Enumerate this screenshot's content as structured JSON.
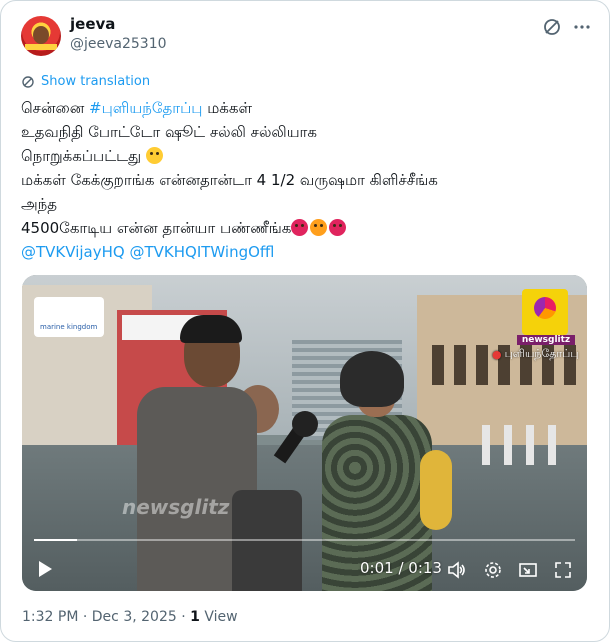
{
  "author": {
    "name": "jeeva",
    "handle": "@jeeva25310"
  },
  "translate_label": "Show translation",
  "tweet": {
    "line1_prefix": "சென்னை ",
    "line1_hashtag": "#புளியந்தோப்பு",
    "line1_suffix": " மக்கள்",
    "line2": " உதவநிதி போட்டோ ஷூட் சல்லி சல்லியாக",
    "line3": "நொறுக்கப்பட்டது",
    "line4": "மக்கள் கேக்குறாங்க என்னதான்டா 4 1/2 வருஷமா கிளிச்சீங்க",
    "line5": "அந்த",
    "line6": "4500கோடிய என்ன தான்யா பண்ணீங்க",
    "mention1": "@TVKVijayHQ",
    "mention2": "@TVKHQITWingOffl"
  },
  "video": {
    "brand": "newsglitz",
    "location": "புளியந்தோப்பு",
    "sign_text": "marine kingdom",
    "current_time": "0:01",
    "duration": "0:13",
    "progress": 0.08,
    "time_display": "0:01 / 0:13"
  },
  "meta": {
    "time": "1:32 PM",
    "date": "Dec 3, 2025",
    "views_count": "1",
    "views_label": "View"
  },
  "icons": [
    "grok-icon",
    "more-icon",
    "translate-icon",
    "play-icon",
    "volume-icon",
    "gear-icon",
    "pip-icon",
    "fullscreen-icon"
  ],
  "colors": {
    "link": "#1d9bf0",
    "muted": "#536471",
    "text": "#0f1419"
  }
}
